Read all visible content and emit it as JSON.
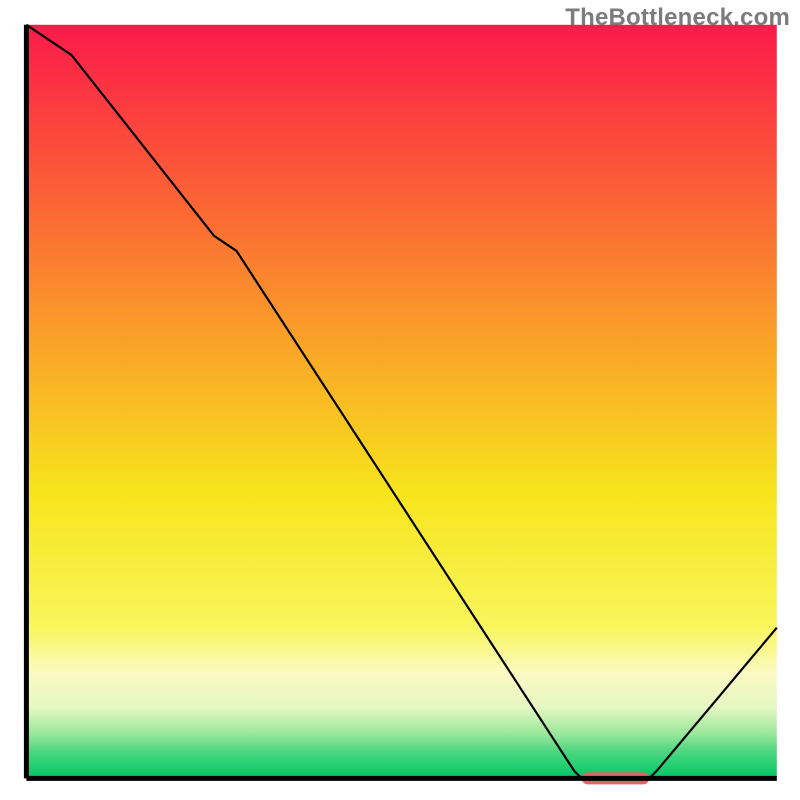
{
  "watermark": "TheBottleneck.com",
  "chart_data": {
    "type": "line",
    "title": "",
    "xlabel": "",
    "ylabel": "",
    "x_range": [
      0,
      100
    ],
    "y_range": [
      0,
      100
    ],
    "series": [
      {
        "name": "curve",
        "x": [
          0,
          6,
          25,
          28,
          73,
          74,
          83,
          84,
          100
        ],
        "values": [
          100,
          96,
          72,
          70,
          1,
          0,
          0,
          1,
          20
        ]
      }
    ],
    "optimal_zone": {
      "x_start": 74,
      "x_end": 83,
      "y": 0
    },
    "axes": {
      "left": {
        "x": 3.3,
        "y0": 3.1,
        "y1": 97.3
      },
      "bottom": {
        "y": 97.3,
        "x0": 3.3,
        "x1": 97.1
      }
    },
    "gradient_stops": [
      {
        "offset": 0.0,
        "color": "#fb1a4a"
      },
      {
        "offset": 0.2,
        "color": "#fb5937"
      },
      {
        "offset": 0.42,
        "color": "#faa228"
      },
      {
        "offset": 0.62,
        "color": "#f7e41c"
      },
      {
        "offset": 0.8,
        "color": "#f8f65d"
      },
      {
        "offset": 0.86,
        "color": "#fbfac2"
      },
      {
        "offset": 0.905,
        "color": "#e6f7c2"
      },
      {
        "offset": 0.94,
        "color": "#9be89c"
      },
      {
        "offset": 0.965,
        "color": "#4bd67f"
      },
      {
        "offset": 1.0,
        "color": "#00c765"
      }
    ],
    "marker_color": "#e06666",
    "curve_color": "#000000",
    "axis_color": "#000000"
  }
}
